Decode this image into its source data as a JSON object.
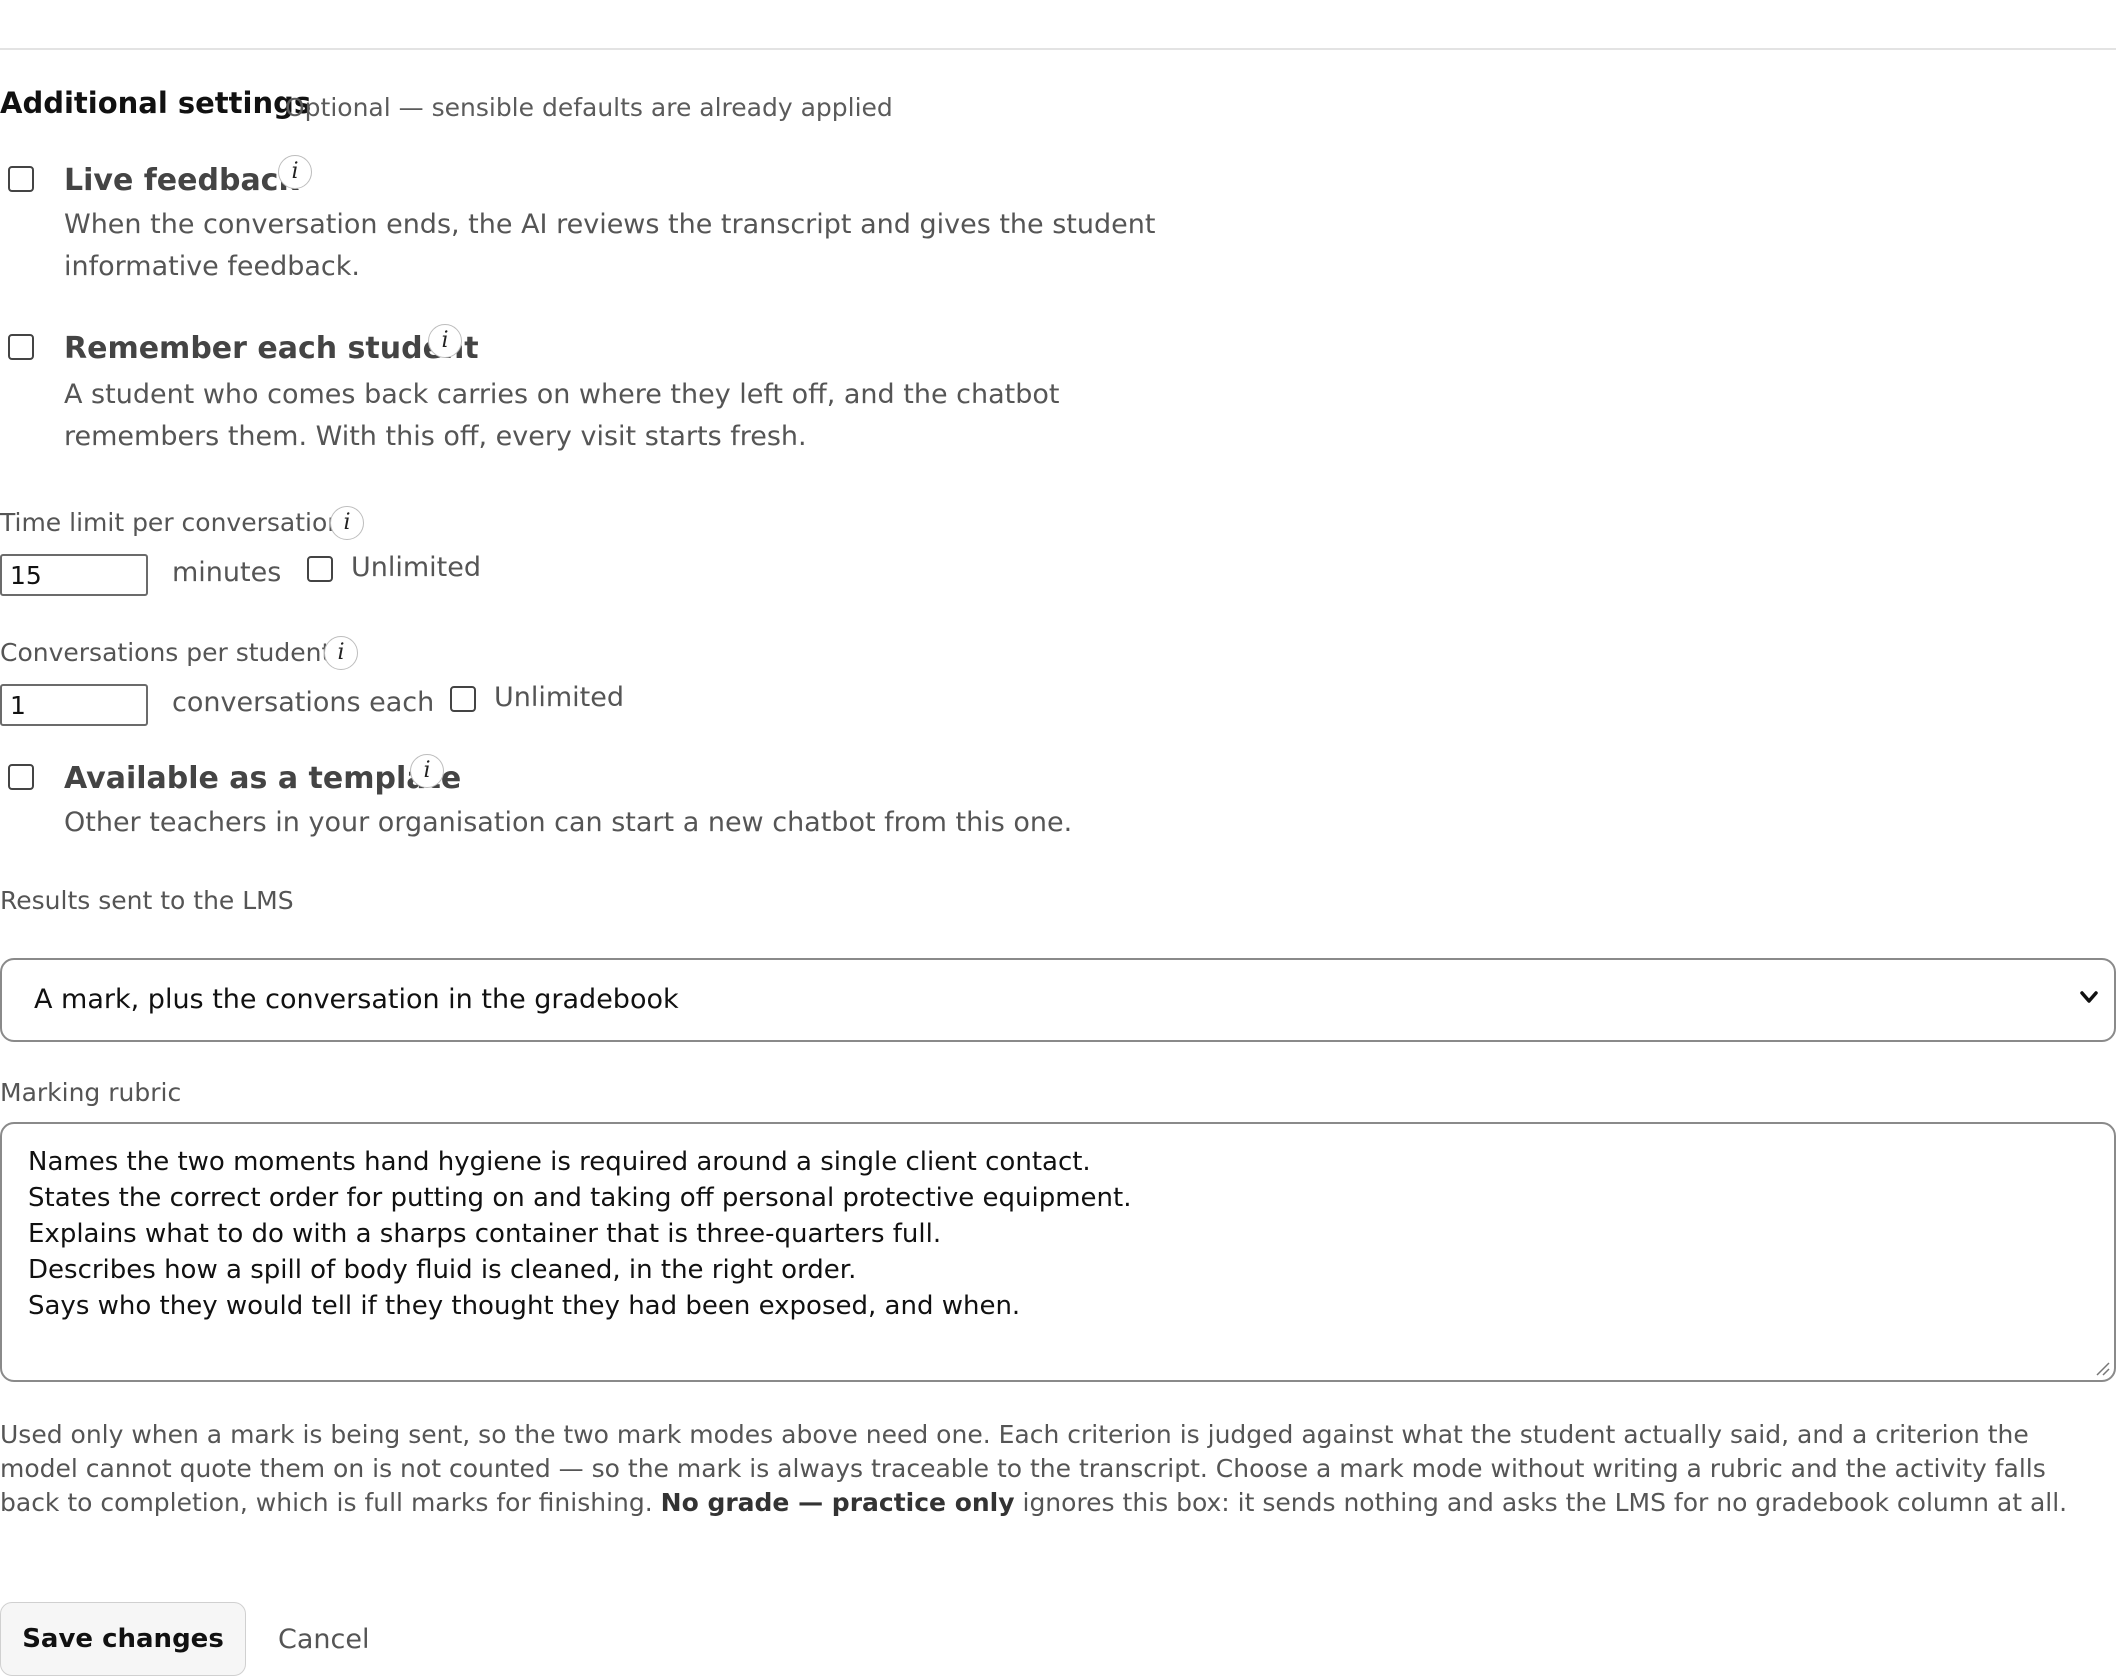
{
  "section": {
    "title": "Additional settings",
    "note": "Optional — sensible defaults are already applied"
  },
  "live_feedback": {
    "title": "Live feedback",
    "description": "When the conversation ends, the AI reviews the transcript and gives the student informative feedback.",
    "checked": false
  },
  "remember_student": {
    "title": "Remember each student",
    "description": "A student who comes back carries on where they left off, and the chatbot remembers them. With this off, every visit starts fresh.",
    "checked": false
  },
  "time_limit": {
    "label": "Time limit per conversation",
    "value": "15",
    "unit": "minutes",
    "unlimited_label": "Unlimited",
    "unlimited_checked": false
  },
  "conversations": {
    "label": "Conversations per student",
    "value": "1",
    "unit": "conversations each",
    "unlimited_label": "Unlimited",
    "unlimited_checked": false
  },
  "template": {
    "title": "Available as a template",
    "description": "Other teachers in your organisation can start a new chatbot from this one.",
    "checked": false
  },
  "lms_results": {
    "label": "Results sent to the LMS",
    "selected": "A mark, plus the conversation in the gradebook"
  },
  "rubric": {
    "label": "Marking rubric",
    "lines": [
      "Names the two moments hand hygiene is required around a single client contact.",
      "States the correct order for putting on and taking off personal protective equipment.",
      "Explains what to do with a sharps container that is three-quarters full.",
      "Describes how a spill of body fluid is cleaned, in the right order.",
      "Says who they would tell if they thought they had been exposed, and when."
    ],
    "help_before": "Used only when a mark is being sent, so the two mark modes above need one. Each criterion is judged against what the student actually said, and a criterion the model cannot quote them on is not counted — so the mark is always traceable to the transcript. Choose a mark mode without writing a rubric and the activity falls back to completion, which is full marks for finishing. ",
    "help_bold": "No grade — practice only",
    "help_after": " ignores this box: it sends nothing and asks the LMS for no gradebook column at all."
  },
  "actions": {
    "save_label": "Save changes",
    "cancel_label": "Cancel"
  },
  "icons": {
    "info": "info-icon",
    "chevron": "chevron-down-icon",
    "grip": "resize-grip-icon"
  }
}
